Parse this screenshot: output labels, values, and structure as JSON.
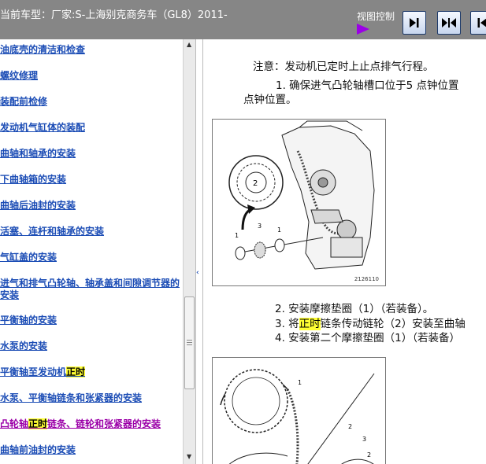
{
  "header": {
    "title": "当前车型：厂家:S-上海别克商务车（GL8）2011-",
    "view_control_label": "视图控制",
    "buttons": [
      "next-page-icon",
      "split-view-icon",
      "previous-page-icon"
    ]
  },
  "sidebar": {
    "items": [
      {
        "label": "油底壳的清洁和检查"
      },
      {
        "label": "螺纹修理"
      },
      {
        "label": "装配前检修"
      },
      {
        "label": "发动机气缸体的装配"
      },
      {
        "label": "曲轴和轴承的安装"
      },
      {
        "label": "下曲轴箱的安装"
      },
      {
        "label": "曲轴后油封的安装"
      },
      {
        "label": "活塞、连杆和轴承的安装"
      },
      {
        "label": "气缸盖的安装"
      },
      {
        "label": "进气和排气凸轮轴、轴承盖和间隙调节器的安装"
      },
      {
        "label": "平衡轴的安装"
      },
      {
        "label": "水泵的安装"
      },
      {
        "label_before": "平衡轴至发动机",
        "label_highlight": "正时",
        "label_after": ""
      },
      {
        "label": "水泵、平衡轴链条和张紧器的安装"
      },
      {
        "label_before": "凸轮轴",
        "label_highlight": "正时",
        "label_after": "链条、链轮和张紧器的安装"
      },
      {
        "label": "曲轴前油封的安装"
      }
    ]
  },
  "content": {
    "note": "注意：发动机已定时上止点排气行程。",
    "step1": "1. 确保进气凸轮轴槽口位于5 点钟位置",
    "step1_cont": "点钟位置。",
    "figure1": {
      "id": "2126110",
      "callouts": [
        "1",
        "2",
        "3",
        "1"
      ]
    },
    "step2": "2. 安装摩擦垫圈（1）（若装备）。",
    "step3_before": "3. 将",
    "step3_highlight": "正时",
    "step3_after": "链条传动链轮（2）安装至曲轴",
    "step4": "4. 安装第二个摩擦垫圈（1）（若装备）",
    "figure2": {
      "callouts": [
        "1",
        "2",
        "3",
        "2"
      ]
    }
  },
  "colors": {
    "header_bg": "#868686",
    "link": "#1b4cb5",
    "visited_link": "#9b00a8",
    "highlight": "#ffff33",
    "flag": "#9b00e6"
  }
}
